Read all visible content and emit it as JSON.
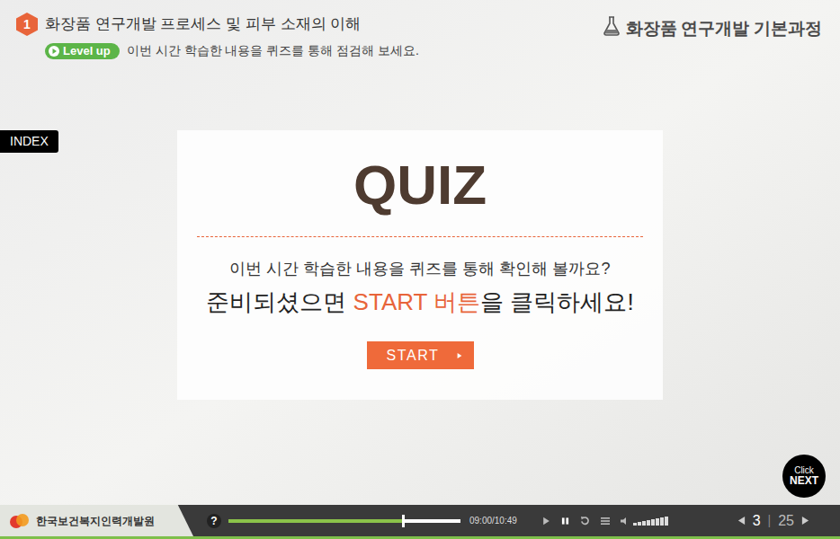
{
  "lesson": {
    "number": "1",
    "title": "화장품 연구개발 프로세스 및 피부 소재의 이해"
  },
  "level_badge": "Level up",
  "subtitle": "이번 시간 학습한 내용을 퀴즈를 통해 점검해 보세요.",
  "course_title": "화장품 연구개발 기본과정",
  "index_tab": "INDEX",
  "quiz": {
    "title": "QUIZ",
    "line1": "이번 시간 학습한 내용을 퀴즈를 통해 확인해 볼까요?",
    "line2_before": "준비되셨으면 ",
    "line2_highlight": "START 버튼",
    "line2_after": "을 클릭하세요!",
    "start_button": "START"
  },
  "next_button": {
    "line1": "Click",
    "line2": "NEXT"
  },
  "player": {
    "org": "한국보건복지인력개발원",
    "help": "?",
    "progress": {
      "level": 0.75
    },
    "time": "09:00/10:49",
    "volume": {
      "level": 1
    },
    "page": {
      "current": "3",
      "separator": "|",
      "total": "25"
    }
  }
}
